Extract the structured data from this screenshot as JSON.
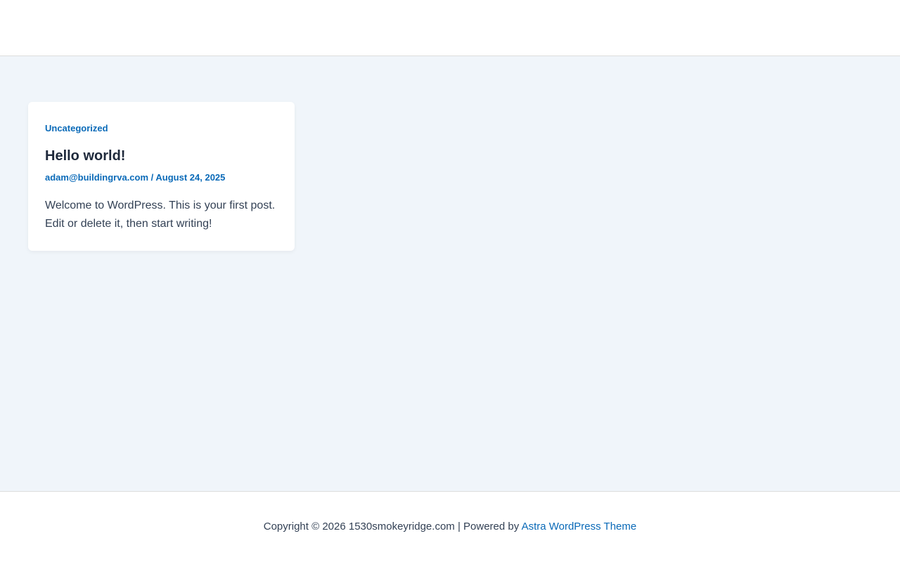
{
  "colors": {
    "accent": "#0a6ab8",
    "page_background": "#f0f5fa",
    "card_background": "#ffffff",
    "heading": "#1e293b",
    "body_text": "#334155"
  },
  "post": {
    "category": "Uncategorized",
    "title": "Hello world!",
    "author": "adam@buildingrva.com",
    "meta_separator": " / ",
    "date": "August 24, 2025",
    "excerpt": "Welcome to WordPress. This is your first post. Edit or delete it, then start writing!"
  },
  "footer": {
    "copyright": "Copyright © 2026 1530smokeyridge.com | Powered by ",
    "theme_link": "Astra WordPress Theme"
  }
}
